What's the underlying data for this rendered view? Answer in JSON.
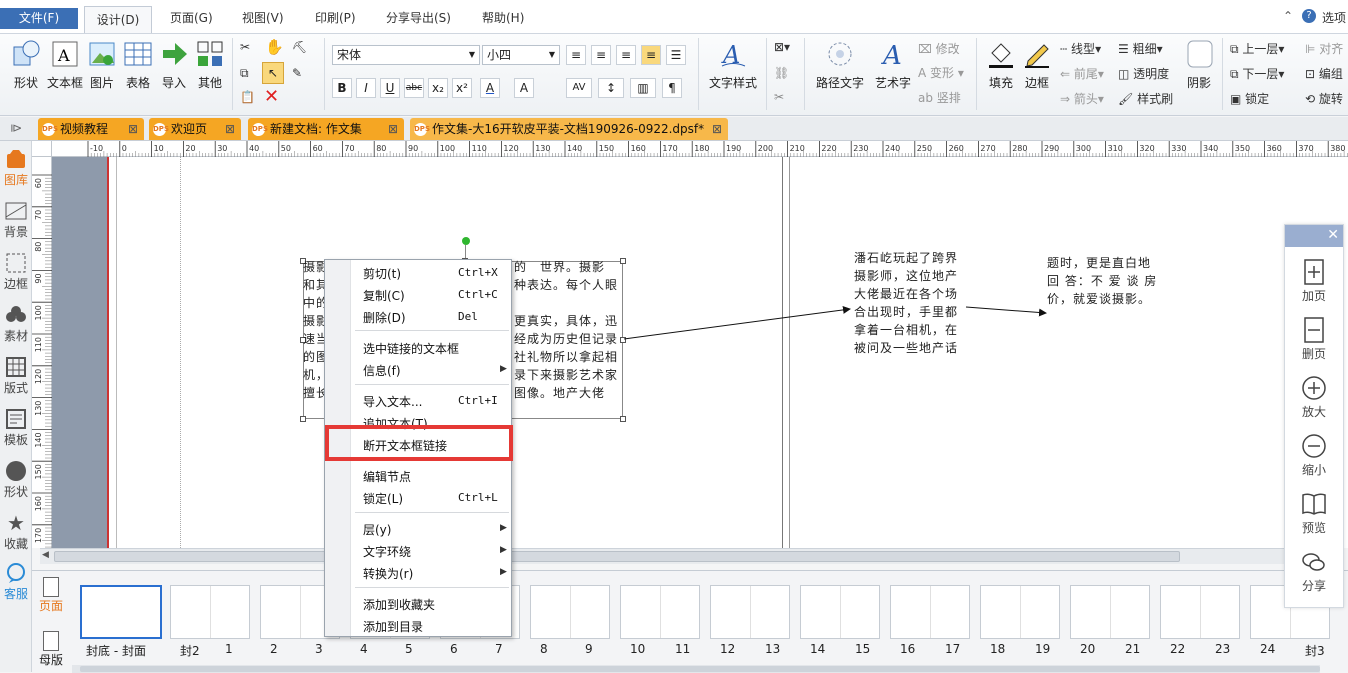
{
  "menubar": {
    "file": "文件(F)",
    "items": [
      "设计(D)",
      "页面(G)",
      "视图(V)",
      "印刷(P)",
      "分享导出(S)",
      "帮助(H)"
    ],
    "options": "选项"
  },
  "ribbon": {
    "big_left": [
      "形状",
      "文本框",
      "图片",
      "表格",
      "导入",
      "其他"
    ],
    "font_name": "宋体",
    "font_size": "小四",
    "format_buttons": [
      "B",
      "I",
      "U",
      "abc",
      "x₂",
      "x²",
      "A",
      "A"
    ],
    "text_style": "文字样式",
    "path_text": "路径文字",
    "art_text": "艺术字",
    "art_tools": [
      "修改",
      "变形",
      "竖排"
    ],
    "fill": "填充",
    "border": "边框",
    "line_tools": [
      "线型",
      "前尾",
      "箭头"
    ],
    "weight_tools": [
      "粗细",
      "透明度",
      "样式刷"
    ],
    "shadow": "阴影",
    "layer_tools": [
      "上一层",
      "下一层",
      "锁定"
    ],
    "align_tools": [
      "对齐",
      "编组",
      "旋转"
    ]
  },
  "tabs": [
    {
      "label": "视频教程"
    },
    {
      "label": "欢迎页"
    },
    {
      "label": "新建文档: 作文集"
    },
    {
      "label": "作文集-大16开软皮平装-文档190926-0922.dpsf*"
    }
  ],
  "leftbar": [
    "图库",
    "背景",
    "边框",
    "素材",
    "版式",
    "模板",
    "形状",
    "收藏",
    "客服"
  ],
  "ruler": {
    "h_ticks": [
      "-10",
      "0",
      "10",
      "20",
      "30",
      "40",
      "50",
      "60",
      "70",
      "80",
      "90",
      "100",
      "110",
      "120",
      "130",
      "140",
      "150",
      "160",
      "170",
      "180",
      "190",
      "200",
      "210",
      "220",
      "230",
      "240",
      "250",
      "260",
      "270",
      "280",
      "290",
      "300",
      "310",
      "320",
      "330",
      "340",
      "350",
      "360",
      "370",
      "380"
    ],
    "v_ticks": [
      "60",
      "70",
      "80",
      "90",
      "100",
      "110",
      "120",
      "130",
      "140",
      "150",
      "160",
      "170"
    ]
  },
  "canvas": {
    "frame1_lines": [
      "摄影",
      "和其",
      "中的",
      "摄影",
      "速当",
      "的图",
      "机，",
      "擅长"
    ],
    "frame1_right": [
      "的　世界。摄影",
      "种表达。每个人眼",
      "",
      "更真实，具体，迅",
      "经成为历史但记录",
      "社礼物所以拿起相",
      "录下来摄影艺术家",
      "图像。地产大佬"
    ],
    "frame2": [
      "潘石屹玩起了跨界",
      "摄影师，这位地产",
      "大佬最近在各个场",
      "合出现时，手里都",
      "拿着一台相机，在",
      "被问及一些地产话"
    ],
    "frame3": [
      "题时，更是直白地",
      "回 答：不 爱 谈 房",
      "价，就爱谈摄影。"
    ]
  },
  "context_menu": {
    "items": [
      {
        "label": "剪切(t)",
        "shortcut": "Ctrl+X"
      },
      {
        "label": "复制(C)",
        "shortcut": "Ctrl+C"
      },
      {
        "label": "删除(D)",
        "shortcut": "Del"
      },
      {
        "label": "选中链接的文本框",
        "shortcut": ""
      },
      {
        "label": "信息(f)",
        "shortcut": ""
      },
      {
        "label": "导入文本...",
        "shortcut": "Ctrl+I"
      },
      {
        "label": "追加文本(T)",
        "shortcut": ""
      },
      {
        "label": "断开文本框链接",
        "shortcut": ""
      },
      {
        "label": "编辑节点",
        "shortcut": ""
      },
      {
        "label": "锁定(L)",
        "shortcut": "Ctrl+L"
      },
      {
        "label": "层(y)",
        "shortcut": ""
      },
      {
        "label": "文字环绕",
        "shortcut": ""
      },
      {
        "label": "转换为(r)",
        "shortcut": ""
      },
      {
        "label": "添加到收藏夹",
        "shortcut": ""
      },
      {
        "label": "添加到目录",
        "shortcut": ""
      }
    ]
  },
  "thumbbar": {
    "page_label": "页面",
    "master_label": "母版",
    "labels": [
      "封底 - 封面",
      "封2",
      "1",
      "2",
      "3",
      "4",
      "5",
      "6",
      "7",
      "8",
      "9",
      "10",
      "11",
      "12",
      "13",
      "14",
      "15",
      "16",
      "17",
      "18",
      "19",
      "20",
      "21",
      "22",
      "23",
      "24",
      "封3"
    ]
  },
  "right_panel": {
    "items": [
      "加页",
      "删页",
      "放大",
      "缩小",
      "预览",
      "分享"
    ]
  },
  "colors": {
    "accent": "#3b6fb5",
    "tab": "#f5a623",
    "highlight": "#e53935",
    "canvas_gray": "#8e9aab"
  }
}
